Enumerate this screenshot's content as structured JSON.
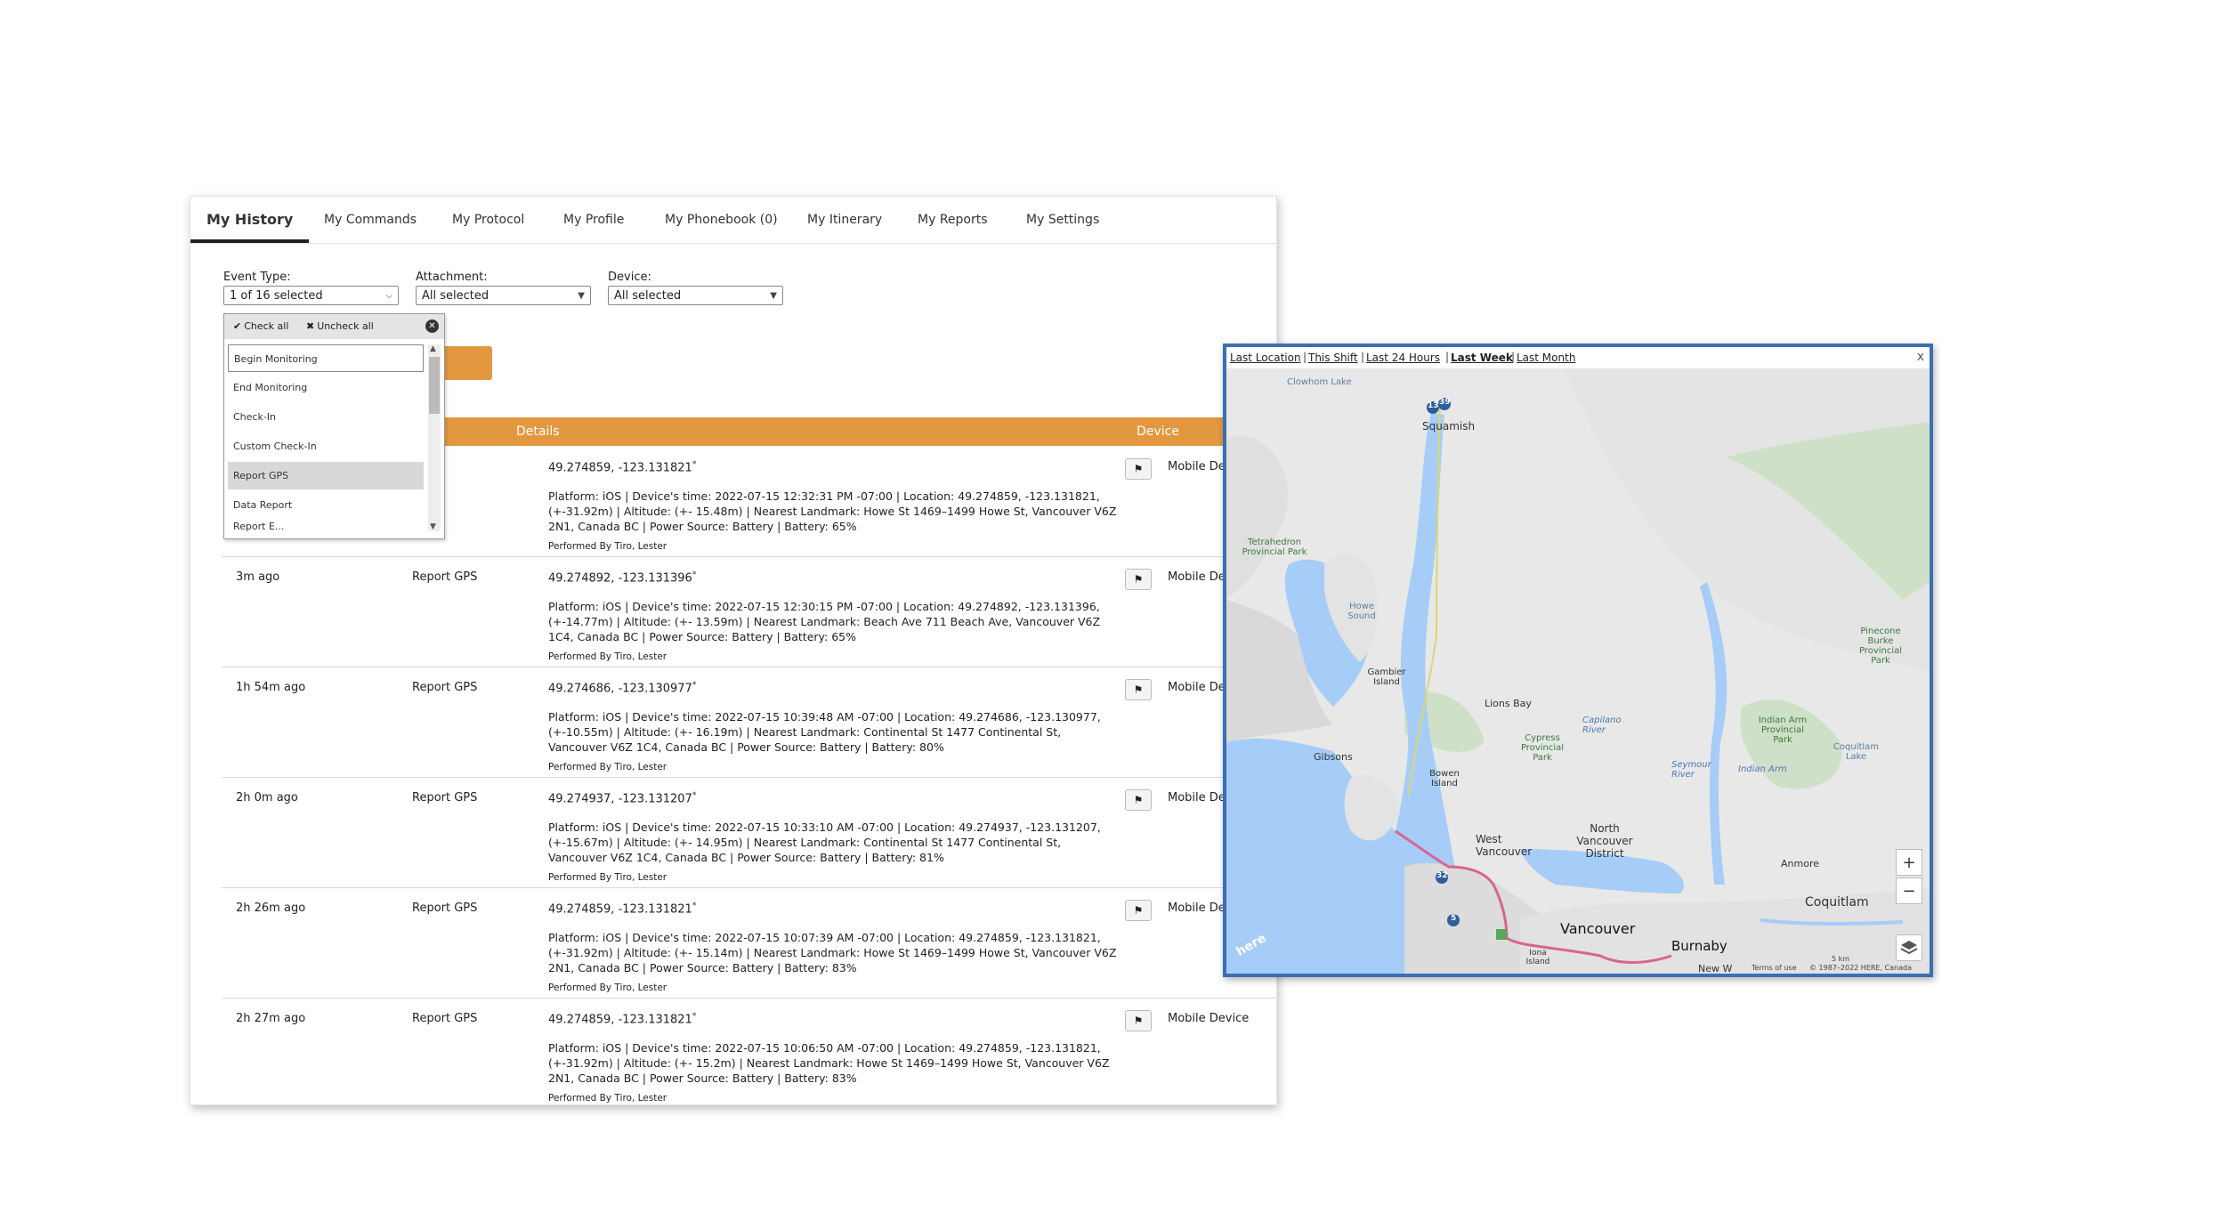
{
  "tabs": [
    {
      "label": "My History"
    },
    {
      "label": "My Commands"
    },
    {
      "label": "My Protocol"
    },
    {
      "label": "My Profile"
    },
    {
      "label": "My Phonebook (0)"
    },
    {
      "label": "My Itinerary"
    },
    {
      "label": "My Reports"
    },
    {
      "label": "My Settings"
    }
  ],
  "filters": {
    "event_type": {
      "label": "Event Type:",
      "value": "1 of 16 selected"
    },
    "attachment": {
      "label": "Attachment:",
      "value": "All selected"
    },
    "device": {
      "label": "Device:",
      "value": "All selected"
    }
  },
  "dropdown": {
    "check_all": "Check all",
    "uncheck_all": "Uncheck all",
    "items": [
      "Begin Monitoring",
      "End Monitoring",
      "Check-In",
      "Custom Check-In",
      "Report GPS",
      "Data Report",
      "Report E..."
    ]
  },
  "table": {
    "col_details": "Details",
    "col_device": "Device"
  },
  "rows": [
    {
      "time": "",
      "event": "",
      "coord": "49.274859, -123.131821",
      "desc": "Platform: iOS | Device's time: 2022-07-15 12:32:31 PM -07:00 | Location: 49.274859, -123.131821, (+-31.92m) | Altitude: (+- 15.48m) | Nearest Landmark: Howe St 1469–1499 Howe St, Vancouver V6Z 2N1, Canada BC | Power Source: Battery | Battery: 65%",
      "performed": "Performed By Tiro, Lester",
      "device": "Mobile De"
    },
    {
      "time": "3m ago",
      "event": "Report GPS",
      "coord": "49.274892, -123.131396",
      "desc": "Platform: iOS | Device's time: 2022-07-15 12:30:15 PM -07:00 | Location: 49.274892, -123.131396, (+-14.77m) | Altitude: (+- 13.59m) | Nearest Landmark: Beach Ave 711 Beach Ave, Vancouver V6Z 1C4, Canada BC | Power Source: Battery | Battery: 65%",
      "performed": "Performed By Tiro, Lester",
      "device": "Mobile De"
    },
    {
      "time": "1h 54m ago",
      "event": "Report GPS",
      "coord": "49.274686, -123.130977",
      "desc": "Platform: iOS | Device's time: 2022-07-15 10:39:48 AM -07:00 | Location: 49.274686, -123.130977, (+-10.55m) | Altitude: (+- 16.19m) | Nearest Landmark: Continental St 1477 Continental St, Vancouver V6Z 1C4, Canada BC | Power Source: Battery | Battery: 80%",
      "performed": "Performed By Tiro, Lester",
      "device": "Mobile De"
    },
    {
      "time": "2h 0m ago",
      "event": "Report GPS",
      "coord": "49.274937, -123.131207",
      "desc": "Platform: iOS | Device's time: 2022-07-15 10:33:10 AM -07:00 | Location: 49.274937, -123.131207, (+-15.67m) | Altitude: (+- 14.95m) | Nearest Landmark: Continental St 1477 Continental St, Vancouver V6Z 1C4, Canada BC | Power Source: Battery | Battery: 81%",
      "performed": "Performed By Tiro, Lester",
      "device": "Mobile De"
    },
    {
      "time": "2h 26m ago",
      "event": "Report GPS",
      "coord": "49.274859, -123.131821",
      "desc": "Platform: iOS | Device's time: 2022-07-15 10:07:39 AM -07:00 | Location: 49.274859, -123.131821, (+-31.92m) | Altitude: (+- 15.14m) | Nearest Landmark: Howe St 1469–1499 Howe St, Vancouver V6Z 2N1, Canada BC | Power Source: Battery | Battery: 83%",
      "performed": "Performed By Tiro, Lester",
      "device": "Mobile De"
    },
    {
      "time": "2h 27m ago",
      "event": "Report GPS",
      "coord": "49.274859, -123.131821",
      "desc": "Platform: iOS | Device's time: 2022-07-15 10:06:50 AM -07:00 | Location: 49.274859, -123.131821, (+-31.92m) | Altitude: (+- 15.2m) | Nearest Landmark: Howe St 1469–1499 Howe St, Vancouver V6Z 2N1, Canada BC | Power Source: Battery | Battery: 83%",
      "performed": "Performed By Tiro, Lester",
      "device": "Mobile Device"
    }
  ],
  "map": {
    "links": [
      "Last Location",
      "This Shift",
      "Last 24 Hours",
      "Last Week",
      "Last Month"
    ],
    "active_link": "Last Week",
    "close": "x",
    "labels": {
      "clowhom": "Clowhom Lake",
      "squamish": "Squamish",
      "tetrahedron": "Tetrahedron Provincial Park",
      "howe_sound": "Howe Sound",
      "gambier": "Gambier Island",
      "lions_bay": "Lions Bay",
      "capilano": "Capilano River",
      "cypress": "Cypress Provincial Park",
      "gibsons": "Gibsons",
      "bowen": "Bowen Island",
      "seymour": "Seymour River",
      "indian_arm_park": "Indian Arm Provincial Park",
      "indian_arm": "Indian Arm",
      "coquitlam_lake": "Coquitlam Lake",
      "pinecone": "Pinecone Burke Provincial Park",
      "north_van": "North Vancouver District",
      "west_van": "West Vancouver",
      "vancouver": "Vancouver",
      "burnaby": "Burnaby",
      "anmore": "Anmore",
      "coquitlam": "Coquitlam",
      "iona": "Iona Island",
      "new_w": "New W",
      "here_logo": "here"
    },
    "markers": [
      "13",
      "39",
      "32",
      "5"
    ],
    "zoom_in": "+",
    "zoom_out": "−",
    "scale": "5 km",
    "terms": "Terms of use",
    "copyright": "© 1987–2022 HERE, Canada",
    "colors": {
      "border": "#3a6fb5",
      "water": "#a6cdf7",
      "land": "#e8e8e8",
      "route": "#d8658c",
      "marker": "#2f5d9e"
    }
  },
  "colors": {
    "accent": "#e39840"
  }
}
